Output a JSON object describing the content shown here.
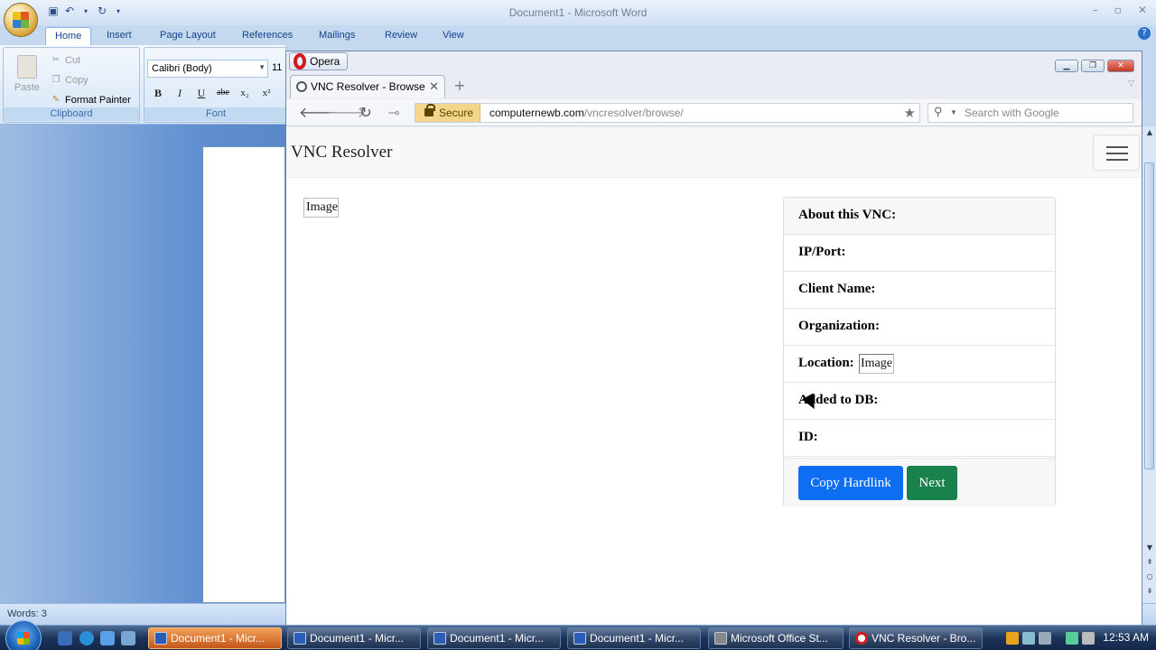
{
  "word": {
    "title": "Document1 - Microsoft Word",
    "tabs": [
      "Home",
      "Insert",
      "Page Layout",
      "References",
      "Mailings",
      "Review",
      "View"
    ],
    "clipboard": {
      "paste": "Paste",
      "cut": "Cut",
      "copy": "Copy",
      "format_painter": "Format Painter",
      "group_label": "Clipboard"
    },
    "font": {
      "name": "Calibri (Body)",
      "size": "11",
      "group_label": "Font",
      "buttons": [
        "B",
        "I",
        "U",
        "abe",
        "x₂",
        "x²"
      ]
    },
    "status": "Words: 3"
  },
  "opera": {
    "menu_label": "Opera",
    "tab_title": "VNC Resolver - Browse",
    "secure_label": "Secure",
    "url_domain": "computernewb.com",
    "url_path": "/vncresolver/browse/",
    "search_placeholder": "Search with Google"
  },
  "page": {
    "brand": "VNC Resolver",
    "main_image_alt": "Image",
    "card": {
      "header": "About this VNC:",
      "rows": [
        "IP/Port:",
        "Client Name:",
        "Organization:",
        "Location:",
        "Added to DB:",
        "ID:"
      ],
      "location_image_alt": "Image",
      "copy_button": "Copy Hardlink",
      "next_button": "Next"
    }
  },
  "taskbar": {
    "buttons": [
      "Document1 - Micr...",
      "Document1 - Micr...",
      "Document1 - Micr...",
      "Document1 - Micr...",
      "Microsoft Office St...",
      "VNC Resolver - Bro..."
    ],
    "clock": "12:53 AM"
  },
  "colors": {
    "primary_button": "#0d6ef4",
    "success_button": "#19824c",
    "opera_red": "#d21a20"
  }
}
